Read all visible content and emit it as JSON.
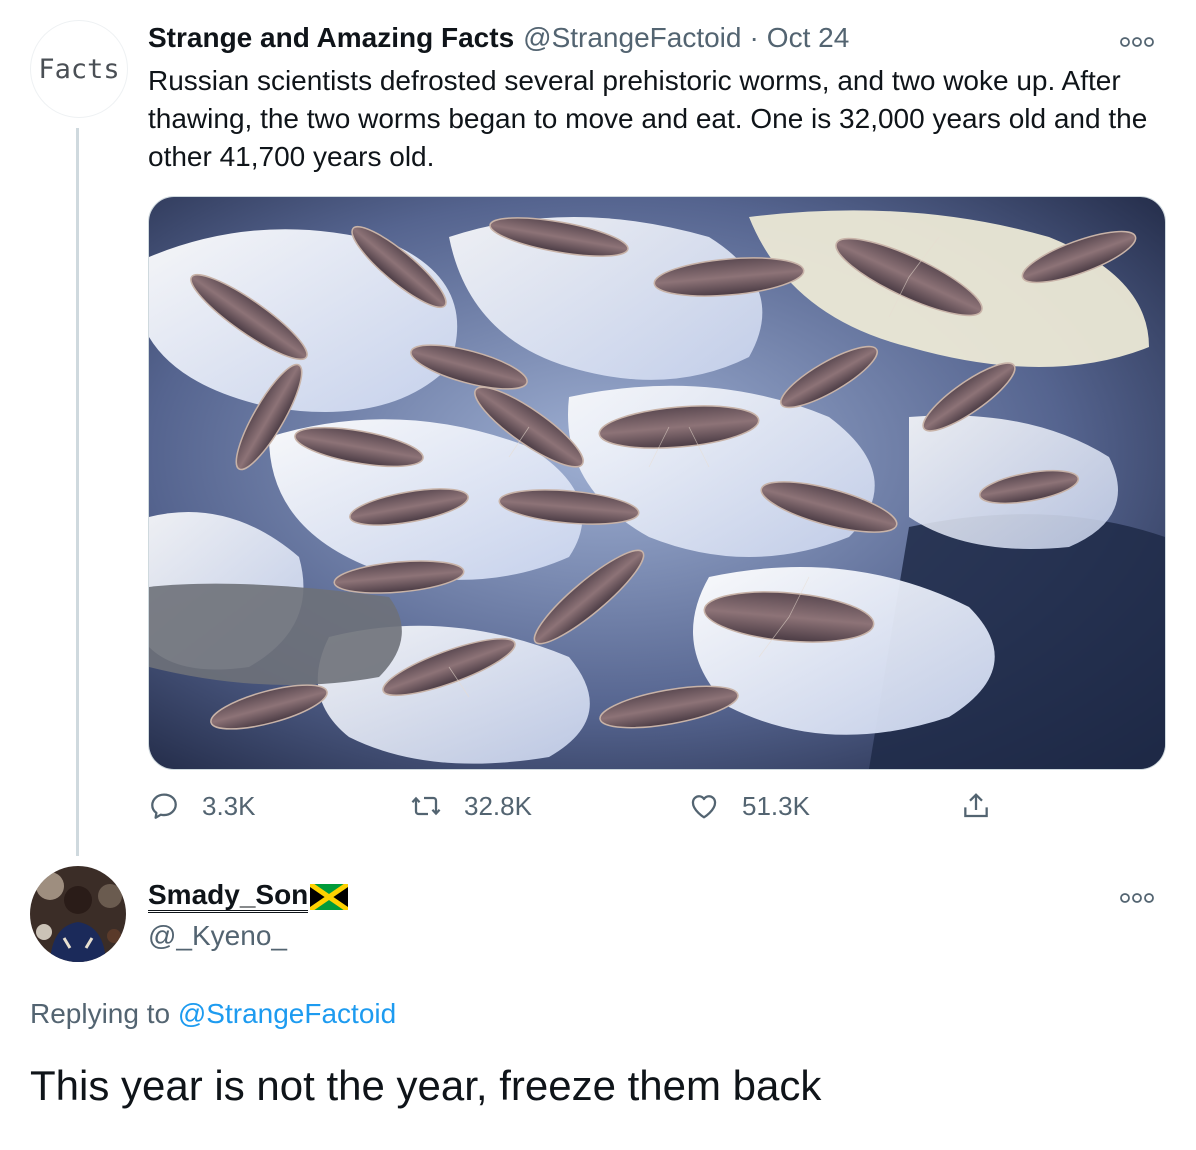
{
  "tweet": {
    "avatar_text": "Facts",
    "display_name": "Strange and Amazing Facts",
    "handle": "@StrangeFactoid",
    "separator": "·",
    "date": "Oct 24",
    "more_icon": "more-icon",
    "text": "Russian scientists defrosted several prehistoric worms, and two woke up. After thawing, the two worms began to move and eat. One is 32,000 years old and the other 41,700 years old.",
    "actions": {
      "replies": "3.3K",
      "retweets": "32.8K",
      "likes": "51.3K"
    }
  },
  "reply": {
    "display_name": "Smady_Son",
    "handle": "@_Kyeno_",
    "replying_label": "Replying to",
    "replying_to": "@StrangeFactoid",
    "text": "This year is not the year, freeze them back"
  },
  "colors": {
    "link": "#1d9bf0",
    "muted": "#536471",
    "text": "#0f1419"
  }
}
